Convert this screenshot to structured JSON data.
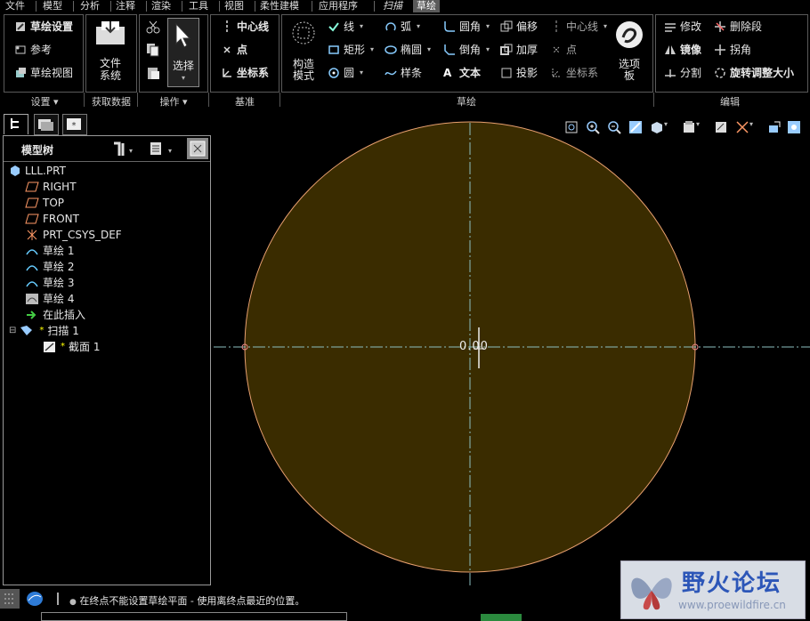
{
  "menubar": {
    "items": [
      "文件",
      "模型",
      "分析",
      "注释",
      "渲染",
      "工具",
      "视图",
      "柔性建模",
      "应用程序",
      "扫描",
      "草绘"
    ]
  },
  "ribbon": {
    "settings": {
      "sketch_setup": "草绘设置",
      "references": "参考",
      "sketch_view": "草绘视图",
      "label": "设置"
    },
    "get_data": {
      "file_system": "文件\n系统",
      "label": "获取数据"
    },
    "operations": {
      "select": "选择",
      "label": "操作"
    },
    "datum": {
      "centerline": "中心线",
      "point": "点",
      "csys": "坐标系",
      "label": "基准"
    },
    "sketch": {
      "construction_mode": "构造\n模式",
      "line": "线",
      "rectangle": "矩形",
      "circle": "圆",
      "arc": "弧",
      "ellipse": "椭圆",
      "spline": "样条",
      "fillet": "圆角",
      "chamfer": "倒角",
      "text": "文本",
      "offset": "偏移",
      "thicken": "加厚",
      "project": "投影",
      "centerline": "中心线",
      "point": "点",
      "csys": "坐标系",
      "palette": "选项\n板",
      "label": "草绘"
    },
    "edit": {
      "modify": "修改",
      "delete_segment": "删除段",
      "mirror": "镜像",
      "corner": "拐角",
      "divide": "分割",
      "rotate_resize": "旋转调整大小",
      "label": "编辑"
    }
  },
  "tree": {
    "title": "模型树",
    "items": [
      {
        "label": "LLL.PRT"
      },
      {
        "label": "RIGHT"
      },
      {
        "label": "TOP"
      },
      {
        "label": "FRONT"
      },
      {
        "label": "PRT_CSYS_DEF"
      },
      {
        "label": "草绘 1"
      },
      {
        "label": "草绘 2"
      },
      {
        "label": "草绘 3"
      },
      {
        "label": "草绘 4"
      },
      {
        "label": "在此插入"
      },
      {
        "label": "扫描 1"
      },
      {
        "label": "截面 1"
      }
    ]
  },
  "canvas": {
    "origin_label": "0.00"
  },
  "status": {
    "message": "在终点不能设置草绘平面 - 使用离终点最近的位置。"
  },
  "watermark": {
    "title": "野火论坛",
    "url": "www.proewildfire.cn"
  },
  "colors": {
    "fill": "#3a2c00",
    "circle": "#e8a070",
    "axis": "#8cc0c0",
    "accent": "#2e7bd6"
  }
}
